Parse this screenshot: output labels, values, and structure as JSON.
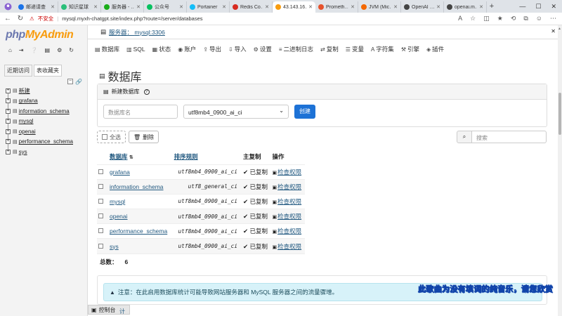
{
  "browser": {
    "tabs": [
      {
        "label": "邮递请查",
        "color": "#1a73e8",
        "active": false
      },
      {
        "label": "知识星球",
        "color": "#2bbf7a",
        "active": false
      },
      {
        "label": "服务器 - …",
        "color": "#1aad19",
        "active": false
      },
      {
        "label": "公众号",
        "color": "#07c160",
        "active": false
      },
      {
        "label": "Portainer",
        "color": "#13bef9",
        "active": false
      },
      {
        "label": "Redis Co…",
        "color": "#d82c20",
        "active": false
      },
      {
        "label": "43.143.16…",
        "color": "#f89c0e",
        "active": true
      },
      {
        "label": "Prometh…",
        "color": "#e6522c",
        "active": false
      },
      {
        "label": "JVM (Mic…",
        "color": "#f46800",
        "active": false
      },
      {
        "label": "OpenAI …",
        "color": "#444444",
        "active": false
      },
      {
        "label": "openai.m…",
        "color": "#444444",
        "active": false
      }
    ],
    "insecure_label": "不安全",
    "url": "mysql.myxh-chatgpt.site/index.php?route=/server/databases"
  },
  "pma": {
    "logo_php": "php",
    "logo_myadmin": "MyAdmin",
    "nav_tabs": [
      "近期访问",
      "表收藏夹"
    ],
    "tree": [
      {
        "label": "新建",
        "type": "new"
      },
      {
        "label": "grafana",
        "type": "db"
      },
      {
        "label": "information_schema",
        "type": "db"
      },
      {
        "label": "mysql",
        "type": "db"
      },
      {
        "label": "openai",
        "type": "db"
      },
      {
        "label": "performance_schema",
        "type": "db"
      },
      {
        "label": "sys",
        "type": "db"
      }
    ],
    "console_label": "控制台",
    "server_prefix": "服务器：",
    "server_name": "mysql:3306",
    "top_menu": [
      {
        "label": "数据库",
        "icon": "database-icon"
      },
      {
        "label": "SQL",
        "icon": "sql-icon"
      },
      {
        "label": "状态",
        "icon": "status-icon"
      },
      {
        "label": "账户",
        "icon": "accounts-icon"
      },
      {
        "label": "导出",
        "icon": "export-icon"
      },
      {
        "label": "导入",
        "icon": "import-icon"
      },
      {
        "label": "设置",
        "icon": "settings-icon"
      },
      {
        "label": "二进制日志",
        "icon": "binlog-icon"
      },
      {
        "label": "复制",
        "icon": "replication-icon"
      },
      {
        "label": "变量",
        "icon": "variables-icon"
      },
      {
        "label": "字符集",
        "icon": "charset-icon"
      },
      {
        "label": "引擎",
        "icon": "engine-icon"
      },
      {
        "label": "插件",
        "icon": "plugin-icon"
      }
    ],
    "page_title": "数据库",
    "create": {
      "header": "新建数据库",
      "name_placeholder": "数据库名",
      "collation": "utf8mb4_0900_ai_ci",
      "button": "创建"
    },
    "actions": {
      "select_all": "全选",
      "delete": "删除"
    },
    "search_placeholder": "搜索",
    "table": {
      "headers": {
        "db": "数据库",
        "collation": "排序规则",
        "replication": "主复制",
        "action": "操作"
      },
      "rows": [
        {
          "name": "grafana",
          "collation": "utf8mb4_0900_ai_ci",
          "replication": "已复制",
          "action": "检查权限"
        },
        {
          "name": "information_schema",
          "collation": "utf8_general_ci",
          "replication": "已复制",
          "action": "检查权限"
        },
        {
          "name": "mysql",
          "collation": "utf8mb4_0900_ai_ci",
          "replication": "已复制",
          "action": "检查权限"
        },
        {
          "name": "openai",
          "collation": "utf8mb4_0900_ai_ci",
          "replication": "已复制",
          "action": "检查权限"
        },
        {
          "name": "performance_schema",
          "collation": "utf8mb4_0900_ai_ci",
          "replication": "已复制",
          "action": "检查权限"
        },
        {
          "name": "sys",
          "collation": "utf8mb4_0900_ai_ci",
          "replication": "已复制",
          "action": "检查权限"
        }
      ],
      "total_label": "总数：",
      "total_value": "6"
    },
    "notice": "注意：在此启用数据库统计可能导致网站服务器和 MySQL 服务器之间的流量骤增。",
    "notice_trailing": "计"
  },
  "overlay_subtitle": "此歌曲为没有填词的纯音乐，请您欣赏"
}
